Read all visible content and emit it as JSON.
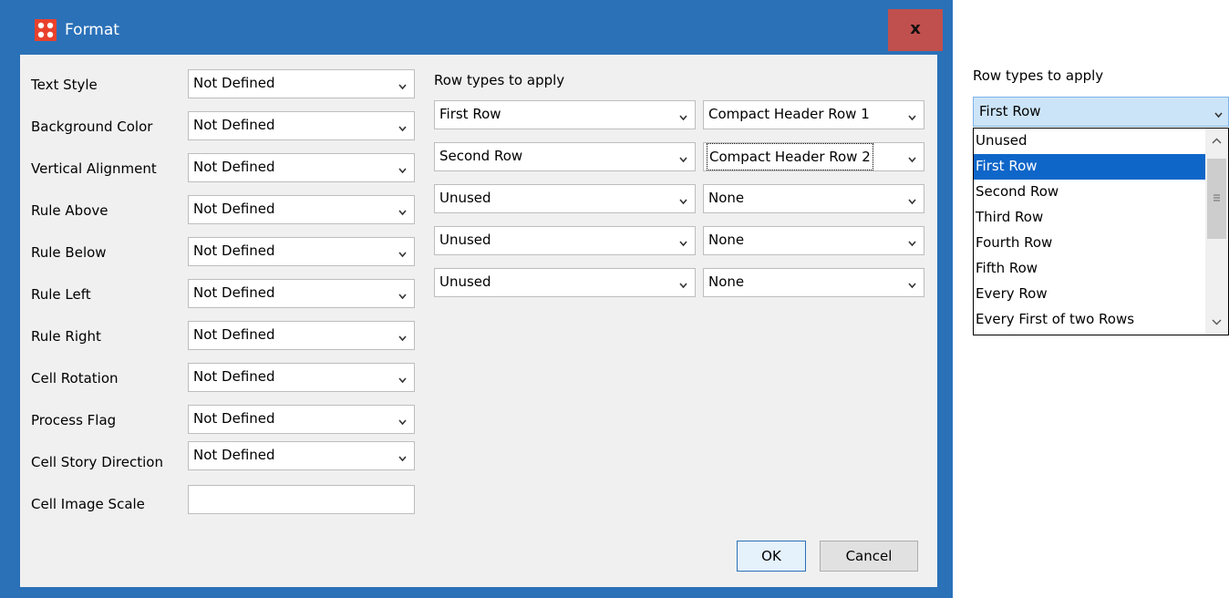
{
  "window": {
    "title": "Format",
    "close_label": "x"
  },
  "fields": [
    {
      "label": "Text Style",
      "value": "Not Defined"
    },
    {
      "label": "Background Color",
      "value": "Not Defined"
    },
    {
      "label": "Vertical Alignment",
      "value": "Not Defined"
    },
    {
      "label": "Rule Above",
      "value": "Not Defined"
    },
    {
      "label": "Rule Below",
      "value": "Not Defined"
    },
    {
      "label": "Rule Left",
      "value": "Not Defined"
    },
    {
      "label": "Rule Right",
      "value": "Not Defined"
    },
    {
      "label": "Cell Rotation",
      "value": "Not Defined"
    },
    {
      "label": "Process Flag",
      "value": "Not Defined"
    },
    {
      "label": "Cell Story Direction",
      "value": "Not Defined"
    }
  ],
  "image_scale": {
    "label": "Cell Image Scale",
    "value": ""
  },
  "row_types": {
    "heading": "Row types to apply",
    "rows": [
      {
        "type": "First Row",
        "style": "Compact Header Row 1"
      },
      {
        "type": "Second Row",
        "style": "Compact Header Row 2"
      },
      {
        "type": "Unused",
        "style": "None"
      },
      {
        "type": "Unused",
        "style": "None"
      },
      {
        "type": "Unused",
        "style": "None"
      }
    ]
  },
  "buttons": {
    "ok": "OK",
    "cancel": "Cancel"
  },
  "dropdown_panel": {
    "heading": "Row types to apply",
    "selected": "First Row",
    "options": [
      "Unused",
      "First Row",
      "Second Row",
      "Third Row",
      "Fourth Row",
      "Fifth Row",
      "Every Row",
      "Every First of two Rows"
    ],
    "highlighted_index": 1
  },
  "colors": {
    "title_bar": "#2a71b8",
    "close_button": "#c0504d",
    "selection": "#0f66c9",
    "app_icon": "#e8412c"
  }
}
